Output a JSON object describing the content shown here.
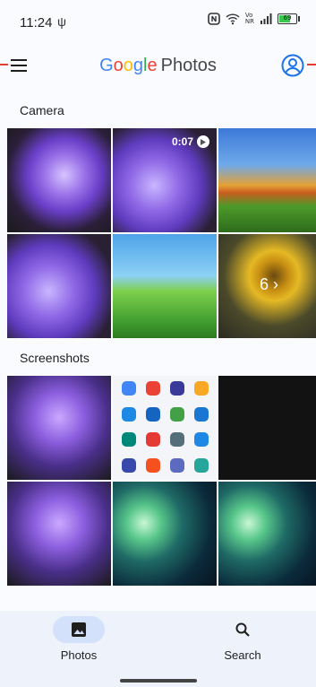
{
  "status_bar": {
    "time": "11:24",
    "usb_symbol": "ψ",
    "network_label_top": "Vo",
    "network_label_bottom": "NR",
    "battery_percent": "69",
    "battery_level": 0.69
  },
  "app_bar": {
    "logo_letters": [
      {
        "char": "G",
        "color": "#4285F4"
      },
      {
        "char": "o",
        "color": "#EA4335"
      },
      {
        "char": "o",
        "color": "#FBBC05"
      },
      {
        "char": "g",
        "color": "#4285F4"
      },
      {
        "char": "l",
        "color": "#34A853"
      },
      {
        "char": "e",
        "color": "#EA4335"
      }
    ],
    "product_name": "Photos",
    "menu_icon": "hamburger-menu-icon",
    "account_icon": "account-circle-icon"
  },
  "sections": [
    {
      "title": "Camera",
      "items": [
        {
          "kind": "flower",
          "label": ""
        },
        {
          "kind": "flower2",
          "label": "0:07",
          "video": true
        },
        {
          "kind": "autumn",
          "label": ""
        },
        {
          "kind": "flower2",
          "label": ""
        },
        {
          "kind": "hill",
          "label": ""
        },
        {
          "kind": "sunflower",
          "label": "6",
          "more": true
        }
      ]
    },
    {
      "title": "Screenshots",
      "items": [
        {
          "kind": "shot-flower",
          "label": ""
        },
        {
          "kind": "shot-apps",
          "label": ""
        },
        {
          "kind": "shot-dark",
          "label": ""
        },
        {
          "kind": "shot-flower",
          "label": ""
        },
        {
          "kind": "planet",
          "label": ""
        },
        {
          "kind": "planet",
          "label": ""
        }
      ]
    }
  ],
  "bottom_nav": {
    "items": [
      {
        "label": "Photos",
        "icon": "photo-icon",
        "active": true
      },
      {
        "label": "Search",
        "icon": "search-icon",
        "active": false
      }
    ]
  },
  "colors": {
    "accent": "#1a73e8",
    "active_pill": "#d3e1fb",
    "nav_background": "#eef2fa",
    "annotation_red": "#e03c31"
  }
}
